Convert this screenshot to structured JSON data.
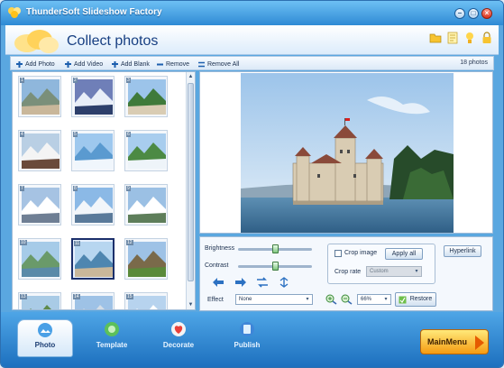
{
  "app": {
    "title": "ThunderSoft Slideshow Factory"
  },
  "window_controls": [
    "minimize",
    "maximize",
    "close"
  ],
  "header": {
    "title": "Collect photos",
    "icons": [
      "folder-icon",
      "note-icon",
      "help-icon",
      "lock-icon"
    ]
  },
  "toolbar": {
    "add_photo": "Add Photo",
    "add_video": "Add Video",
    "add_blank": "Add Blank",
    "remove": "Remove",
    "remove_all": "Remove All",
    "count": "18 photos"
  },
  "thumbnails": {
    "selected_index": 11,
    "items": [
      {
        "num": "1"
      },
      {
        "num": "2"
      },
      {
        "num": "3"
      },
      {
        "num": "4"
      },
      {
        "num": "5"
      },
      {
        "num": "6"
      },
      {
        "num": "7"
      },
      {
        "num": "8"
      },
      {
        "num": "9"
      },
      {
        "num": "10"
      },
      {
        "num": "11"
      },
      {
        "num": "12"
      },
      {
        "num": "13"
      },
      {
        "num": "14"
      },
      {
        "num": "15"
      }
    ]
  },
  "adjust": {
    "brightness_label": "Brightness",
    "contrast_label": "Contrast",
    "brightness_level": 0.5,
    "contrast_level": 0.5,
    "effect_label": "Effect",
    "effect_value": "None"
  },
  "crop": {
    "crop_image_label": "Crop image",
    "apply_all": "Apply all",
    "crop_rate_label": "Crop rate",
    "crop_rate_value": "Custom"
  },
  "zoom": {
    "value": "66%"
  },
  "buttons": {
    "restore": "Restore",
    "hyperlink": "Hyperlink"
  },
  "nav": {
    "photo": "Photo",
    "template": "Template",
    "decorate": "Decorate",
    "publish": "Publish",
    "main_menu": "MainMenu"
  },
  "colors": {
    "title_bar": "#2f8ad4",
    "bottom_bar": "#1c6fbe",
    "accent_orange": "#f59b12"
  }
}
